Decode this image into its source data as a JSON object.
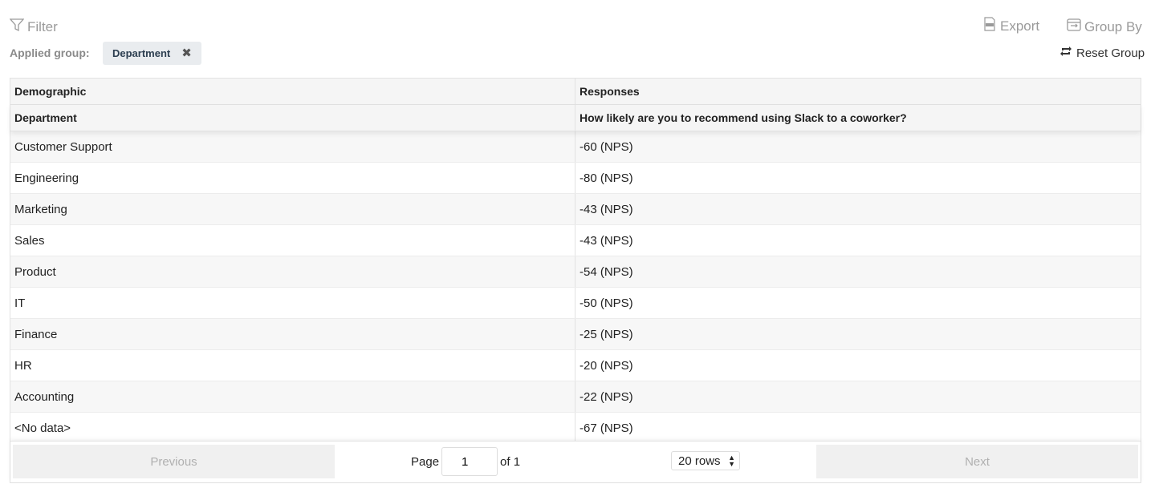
{
  "toolbar": {
    "filter_label": "Filter",
    "applied_group_label": "Applied group:",
    "applied_group_chip": "Department",
    "chip_close": "✖",
    "export_label": "Export",
    "group_by_label": "Group By",
    "reset_group_label": "Reset Group"
  },
  "table": {
    "header1": {
      "col1": "Demographic",
      "col2": "Responses"
    },
    "header2": {
      "col1": "Department",
      "col2": "How likely are you to recommend using Slack to a coworker?"
    },
    "rows": [
      {
        "department": "Customer Support",
        "response": "-60 (NPS)"
      },
      {
        "department": "Engineering",
        "response": "-80 (NPS)"
      },
      {
        "department": "Marketing",
        "response": "-43 (NPS)"
      },
      {
        "department": "Sales",
        "response": "-43 (NPS)"
      },
      {
        "department": "Product",
        "response": "-54 (NPS)"
      },
      {
        "department": "IT",
        "response": "-50 (NPS)"
      },
      {
        "department": "Finance",
        "response": "-25 (NPS)"
      },
      {
        "department": "HR",
        "response": "-20 (NPS)"
      },
      {
        "department": "Accounting",
        "response": "-22 (NPS)"
      },
      {
        "department": "<No data>",
        "response": "-67 (NPS)"
      }
    ]
  },
  "pagination": {
    "previous_label": "Previous",
    "next_label": "Next",
    "page_label": "Page",
    "page_value": "1",
    "of_label": "of 1",
    "rows_select": "20 rows"
  }
}
